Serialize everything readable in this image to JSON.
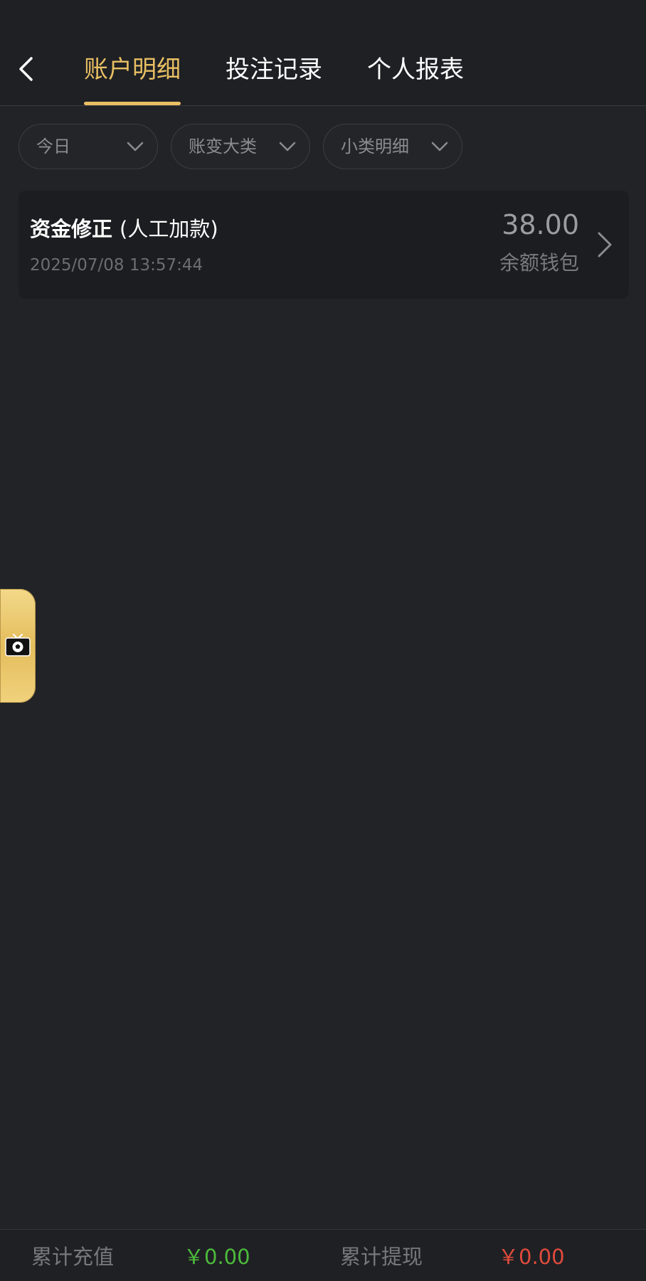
{
  "header": {
    "tabs": [
      {
        "label": "账户明细",
        "active": true
      },
      {
        "label": "投注记录",
        "active": false
      },
      {
        "label": "个人报表",
        "active": false
      }
    ]
  },
  "filters": [
    {
      "label": "今日"
    },
    {
      "label": "账变大类"
    },
    {
      "label": "小类明细"
    }
  ],
  "records": [
    {
      "title": "资金修正",
      "subtitle": "(人工加款)",
      "time": "2025/07/08 13:57:44",
      "amount": "38.00",
      "wallet": "余额钱包"
    }
  ],
  "footer": {
    "recharge_label": "累计充值",
    "recharge_value": "￥0.00",
    "withdraw_label": "累计提现",
    "withdraw_value": "￥0.00"
  },
  "colors": {
    "accent": "#e8bf63",
    "background": "#222327",
    "recharge": "#4cbb3b",
    "withdraw": "#e04b3c"
  },
  "icons": [
    "back-arrow-icon",
    "chevron-down-icon",
    "chevron-right-icon",
    "soccer-tv-icon"
  ]
}
